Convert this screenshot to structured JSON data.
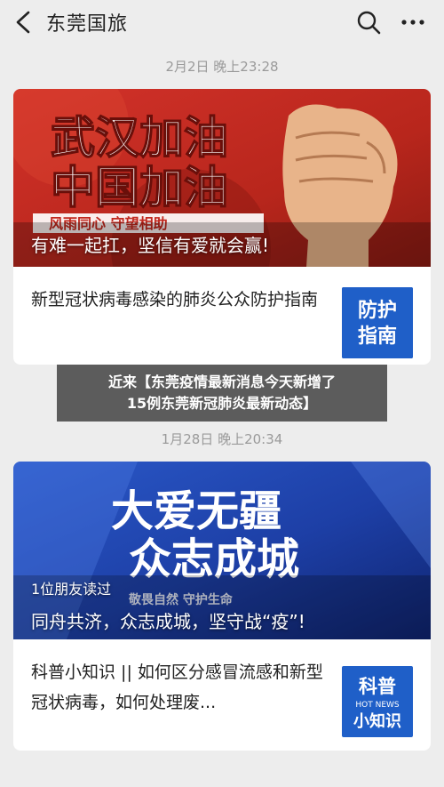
{
  "header": {
    "title": "东莞国旅"
  },
  "posts": [
    {
      "timestamp": "2月2日 晚上23:28",
      "cover_title_line1": "武汉加油",
      "cover_title_line2": "中国加油",
      "cover_strip": "风雨同心 守望相助",
      "caption": "有难一起扛，坚信有爱就会赢!",
      "item_text": "新型冠状病毒感染的肺炎公众防护指南",
      "thumb_line1": "防护",
      "thumb_line2": "指南"
    },
    {
      "timestamp": "1月28日 晚上20:34",
      "cover_title_line1": "大爱无疆",
      "cover_title_line2": "众志成城",
      "cover_strip": "敬畏自然 守护生命",
      "read_count": "1位朋友读过",
      "caption": "同舟共济，众志成城，坚守战“疫”!",
      "item_text": "科普小知识 || 如何区分感冒流感和新型冠状病毒，如何处理废...",
      "thumb_line1": "科普",
      "thumb_small": "HOT NEWS",
      "thumb_line2": "小知识"
    }
  ],
  "overlay": {
    "line1": "近来【东莞疫情最新消息今天新增了",
    "line2": "15例东莞新冠肺炎最新动态】"
  },
  "colors": {
    "red_cover": "#c0271d",
    "blue_cover": "#1d3fa6",
    "thumb_blue": "#1f5fc8"
  }
}
